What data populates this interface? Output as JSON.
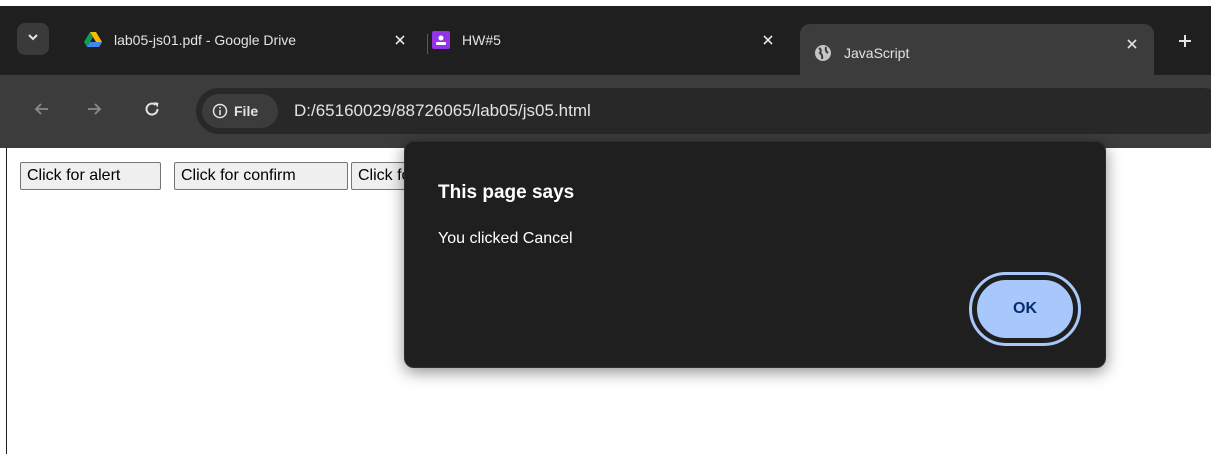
{
  "tabs": [
    {
      "title": "lab05-js01.pdf - Google Drive",
      "icon": "google-drive-icon"
    },
    {
      "title": "HW#5",
      "icon": "classroom-icon"
    },
    {
      "title": "JavaScript",
      "icon": "globe-icon",
      "active": true
    }
  ],
  "toolbar": {
    "site_chip_label": "File",
    "url": "D:/65160029/88726065/lab05/js05.html"
  },
  "page": {
    "buttons": [
      "Click for alert",
      "Click for confirm",
      "Click for prompt"
    ]
  },
  "dialog": {
    "title": "This page says",
    "message": "You clicked Cancel",
    "ok_label": "OK"
  },
  "colors": {
    "chrome_dark": "#1f1f1f",
    "toolbar": "#3c3c3c",
    "accent": "#a8c7fa",
    "ok_text": "#062e6f"
  }
}
